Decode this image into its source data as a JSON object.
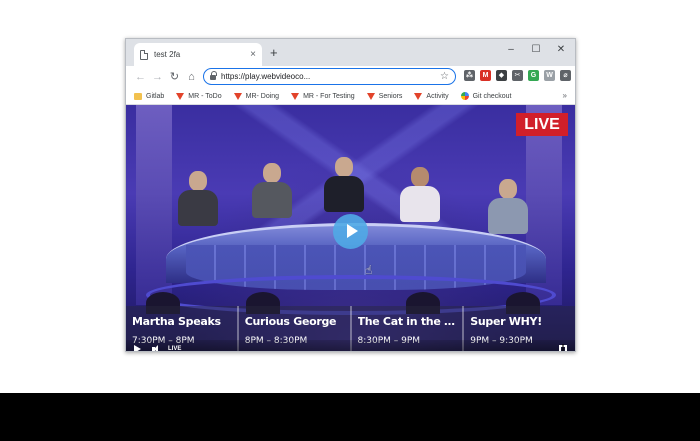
{
  "browser": {
    "tab_title": "test 2fa",
    "tab_close": "×",
    "new_tab": "+",
    "window_controls": {
      "minimize": "–",
      "maximize": "☐",
      "close": "✕"
    },
    "nav": {
      "back": "←",
      "forward": "→",
      "reload": "↻",
      "home": "⌂"
    },
    "url": "https://play.webvideoco...",
    "star": "☆",
    "extensions": [
      {
        "name": "grid-icon",
        "color": "#5f6368",
        "glyph": "⁂"
      },
      {
        "name": "mail-badge-icon",
        "color": "#d93025",
        "glyph": "M"
      },
      {
        "name": "shield-icon",
        "color": "#3c4043",
        "glyph": "◆"
      },
      {
        "name": "scissors-icon",
        "color": "#5f6368",
        "glyph": "✂"
      },
      {
        "name": "refresh-green-icon",
        "color": "#34a853",
        "glyph": "G"
      },
      {
        "name": "document-icon",
        "color": "#9aa0a6",
        "glyph": "W"
      },
      {
        "name": "eyedropper-icon",
        "color": "#5f6368",
        "glyph": "⌀"
      },
      {
        "name": "function-icon",
        "color": "#202124",
        "glyph": "f?"
      },
      {
        "name": "envelope-icon",
        "color": "#3c4043",
        "glyph": "✉"
      },
      {
        "name": "edit-icon",
        "color": "#202124",
        "glyph": "✎"
      },
      {
        "name": "puzzle-icon",
        "color": "#5f6368",
        "glyph": "✚"
      },
      {
        "name": "avatar-icon",
        "color": "#8d6e63",
        "glyph": "●"
      },
      {
        "name": "menu-icon",
        "color": "#5f6368",
        "glyph": "⋮"
      }
    ],
    "bookmarks": [
      {
        "label": "Gitlab",
        "icon": "folder"
      },
      {
        "label": "MR - ToDo",
        "icon": "fox"
      },
      {
        "label": "MR- Doing",
        "icon": "fox"
      },
      {
        "label": "MR - For Testing",
        "icon": "fox"
      },
      {
        "label": "Seniors",
        "icon": "fox"
      },
      {
        "label": "Activity",
        "icon": "fox"
      },
      {
        "label": "Git checkout",
        "icon": "gear"
      }
    ],
    "bookmarks_more": "»"
  },
  "player": {
    "live_badge": "LIVE",
    "controls_live": "LIVE",
    "guide": [
      {
        "title": "Martha Speaks",
        "time": "7:30PM – 8PM"
      },
      {
        "title": "Curious George",
        "time": "8PM – 8:30PM"
      },
      {
        "title": "The Cat in the Hat Kno...",
        "time": "8:30PM – 9PM"
      },
      {
        "title": "Super WHY!",
        "time": "9PM – 9:30PM"
      }
    ]
  }
}
